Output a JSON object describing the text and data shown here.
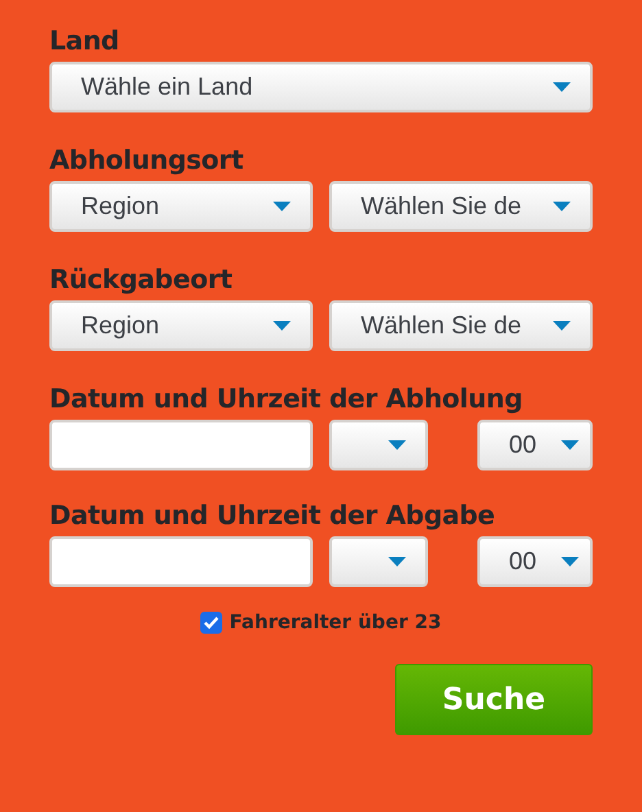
{
  "sections": [
    {
      "label": "Land",
      "kind": "single",
      "controls": [
        {
          "kind": "select",
          "value": "Wähle ein Land"
        }
      ]
    },
    {
      "label": "Abholungsort",
      "kind": "pair",
      "controls": [
        {
          "kind": "select",
          "value": "Region"
        },
        {
          "kind": "select",
          "value": "Wählen Sie de"
        }
      ]
    },
    {
      "label": "Rückgabeort",
      "kind": "pair",
      "controls": [
        {
          "kind": "select",
          "value": "Region"
        },
        {
          "kind": "select",
          "value": "Wählen Sie de"
        }
      ]
    },
    {
      "label": "Datum und Uhrzeit der Abholung",
      "kind": "datetime",
      "controls": [
        {
          "kind": "input"
        },
        {
          "kind": "select"
        },
        {
          "kind": "select",
          "value": "00"
        }
      ]
    },
    {
      "label": "Datum und Uhrzeit der Abgabe",
      "kind": "datetime",
      "controls": [
        {
          "kind": "input"
        },
        {
          "kind": "select"
        },
        {
          "kind": "select",
          "value": "00"
        }
      ]
    }
  ],
  "age_check": {
    "label": "Fahreralter über 23",
    "checked": true
  },
  "submit": "Suche"
}
